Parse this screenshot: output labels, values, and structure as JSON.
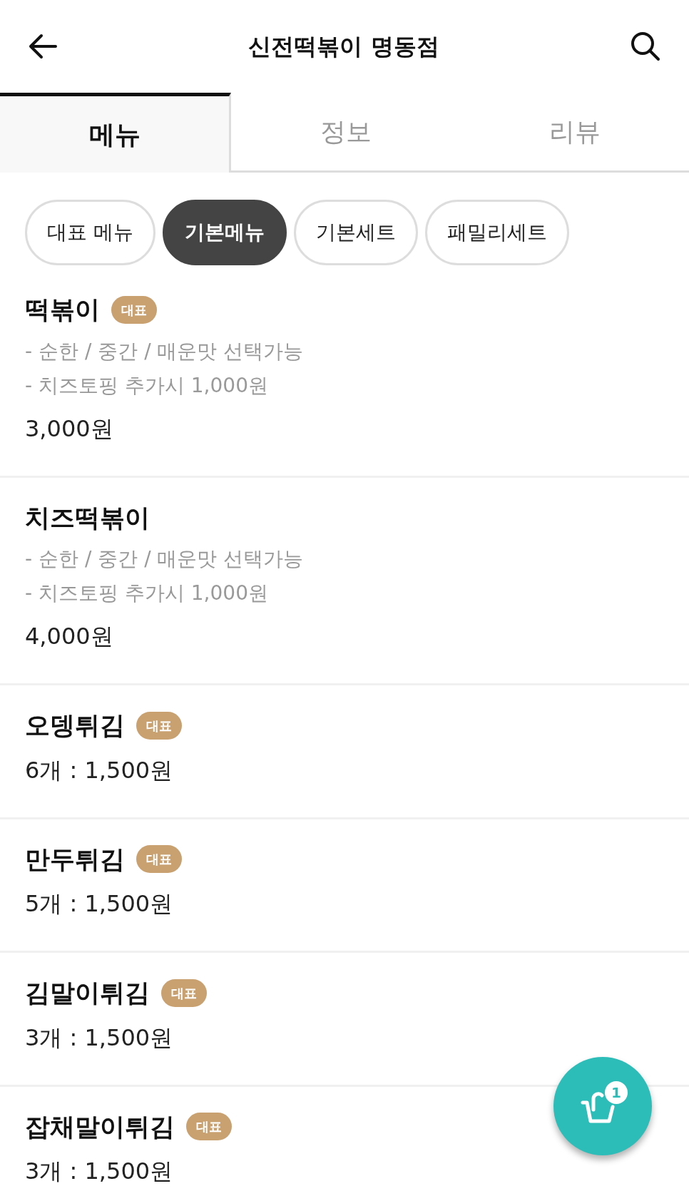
{
  "header": {
    "title": "신전떡볶이 명동점"
  },
  "tabs": [
    {
      "label": "메뉴",
      "selected": true
    },
    {
      "label": "정보",
      "selected": false
    },
    {
      "label": "리뷰",
      "selected": false
    }
  ],
  "categories": [
    {
      "label": "대표 메뉴",
      "selected": false
    },
    {
      "label": "기본메뉴",
      "selected": true
    },
    {
      "label": "기본세트",
      "selected": false
    },
    {
      "label": "패밀리세트",
      "selected": false
    }
  ],
  "menu_items": [
    {
      "name": "떡볶이",
      "badge": "대표",
      "description": [
        "- 순한 / 중간 / 매운맛 선택가능",
        "- 치즈토핑 추가시 1,000원"
      ],
      "price": "3,000원"
    },
    {
      "name": "치즈떡볶이",
      "description": [
        "- 순한 / 중간 / 매운맛 선택가능",
        "- 치즈토핑 추가시 1,000원"
      ],
      "price": "4,000원"
    },
    {
      "name": "오뎅튀김",
      "badge": "대표",
      "price": "6개 : 1,500원"
    },
    {
      "name": "만두튀김",
      "badge": "대표",
      "price": "5개 : 1,500원"
    },
    {
      "name": "김말이튀김",
      "badge": "대표",
      "price": "3개 : 1,500원"
    },
    {
      "name": "잡채말이튀김",
      "badge": "대표",
      "price": "3개 : 1,500원"
    }
  ],
  "cart": {
    "count": "1"
  }
}
